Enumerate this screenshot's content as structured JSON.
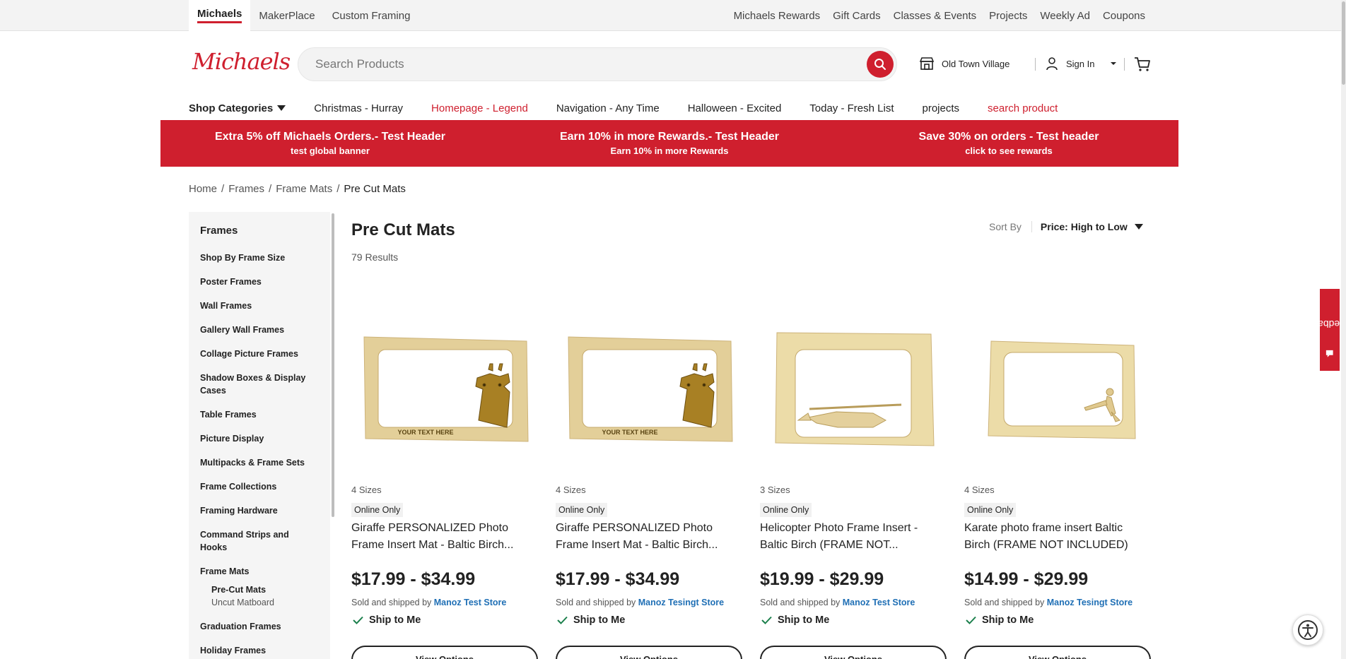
{
  "topbar": {
    "tabs": [
      "Michaels",
      "MakerPlace",
      "Custom Framing"
    ],
    "links": [
      "Michaels Rewards",
      "Gift Cards",
      "Classes & Events",
      "Projects",
      "Weekly Ad",
      "Coupons"
    ]
  },
  "header": {
    "logo": "Michaels",
    "search_placeholder": "Search Products",
    "store": "Old Town Village",
    "signin": "Sign In"
  },
  "nav": {
    "shop_categories": "Shop Categories",
    "items": [
      "Christmas - Hurray",
      "Homepage - Legend",
      "Navigation - Any Time",
      "Halloween - Excited",
      "Today - Fresh List",
      "projects",
      "search product"
    ]
  },
  "promo": [
    {
      "title": "Extra 5% off Michaels Orders.- Test Header",
      "sub": "test global banner"
    },
    {
      "title": "Earn 10% in more Rewards.- Test Header",
      "sub": "Earn 10% in more Rewards"
    },
    {
      "title": "Save 30% on orders - Test header",
      "sub": "click to see rewards"
    }
  ],
  "breadcrumb": [
    "Home",
    "/",
    "Frames",
    "/",
    "Frame Mats",
    "/",
    "Pre Cut Mats"
  ],
  "sidebar": {
    "title": "Frames",
    "items": [
      "Shop By Frame Size",
      "Poster Frames",
      "Wall Frames",
      "Gallery Wall Frames",
      "Collage Picture Frames",
      "Shadow Boxes & Display Cases",
      "Table Frames",
      "Picture Display",
      "Multipacks & Frame Sets",
      "Frame Collections",
      "Framing Hardware",
      "Command Strips and Hooks",
      "Frame Mats"
    ],
    "subitems": [
      "Pre-Cut Mats",
      "Uncut Matboard"
    ],
    "items_after": [
      "Graduation Frames",
      "Holiday Frames"
    ]
  },
  "main": {
    "title": "Pre Cut Mats",
    "results": "79 Results",
    "sort_label": "Sort By",
    "sort_value": "Price: High to Low"
  },
  "products": [
    {
      "sizes": "4 Sizes",
      "badge": "Online Only",
      "name": "Giraffe PERSONALIZED Photo Frame Insert Mat - Baltic Birch...",
      "price": "$17.99 - $34.99",
      "seller_prefix": "Sold and shipped by",
      "seller": "Manoz Test Store",
      "ship": "Ship to Me",
      "button": "View Options",
      "engrave": "YOUR TEXT HERE"
    },
    {
      "sizes": "4 Sizes",
      "badge": "Online Only",
      "name": "Giraffe PERSONALIZED Photo Frame Insert Mat - Baltic Birch...",
      "price": "$17.99 - $34.99",
      "seller_prefix": "Sold and shipped by",
      "seller": "Manoz Tesingt Store",
      "ship": "Ship to Me",
      "button": "View Options",
      "engrave": "YOUR TEXT HERE"
    },
    {
      "sizes": "3 Sizes",
      "badge": "Online Only",
      "name": "Helicopter Photo Frame Insert - Baltic Birch (FRAME NOT...",
      "price": "$19.99 - $29.99",
      "seller_prefix": "Sold and shipped by",
      "seller": "Manoz Test Store",
      "ship": "Ship to Me",
      "button": "View Options"
    },
    {
      "sizes": "4 Sizes",
      "badge": "Online Only",
      "name": "Karate photo frame insert Baltic Birch (FRAME NOT INCLUDED)",
      "price": "$14.99 - $29.99",
      "seller_prefix": "Sold and shipped by",
      "seller": "Manoz Tesingt Store",
      "ship": "Ship to Me",
      "button": "View Options"
    }
  ],
  "feedback": "Feedback",
  "colors": {
    "brand_red": "#cf1f2e",
    "link_blue": "#1f6fb5",
    "sidebar_bg": "#f5f5f5"
  }
}
